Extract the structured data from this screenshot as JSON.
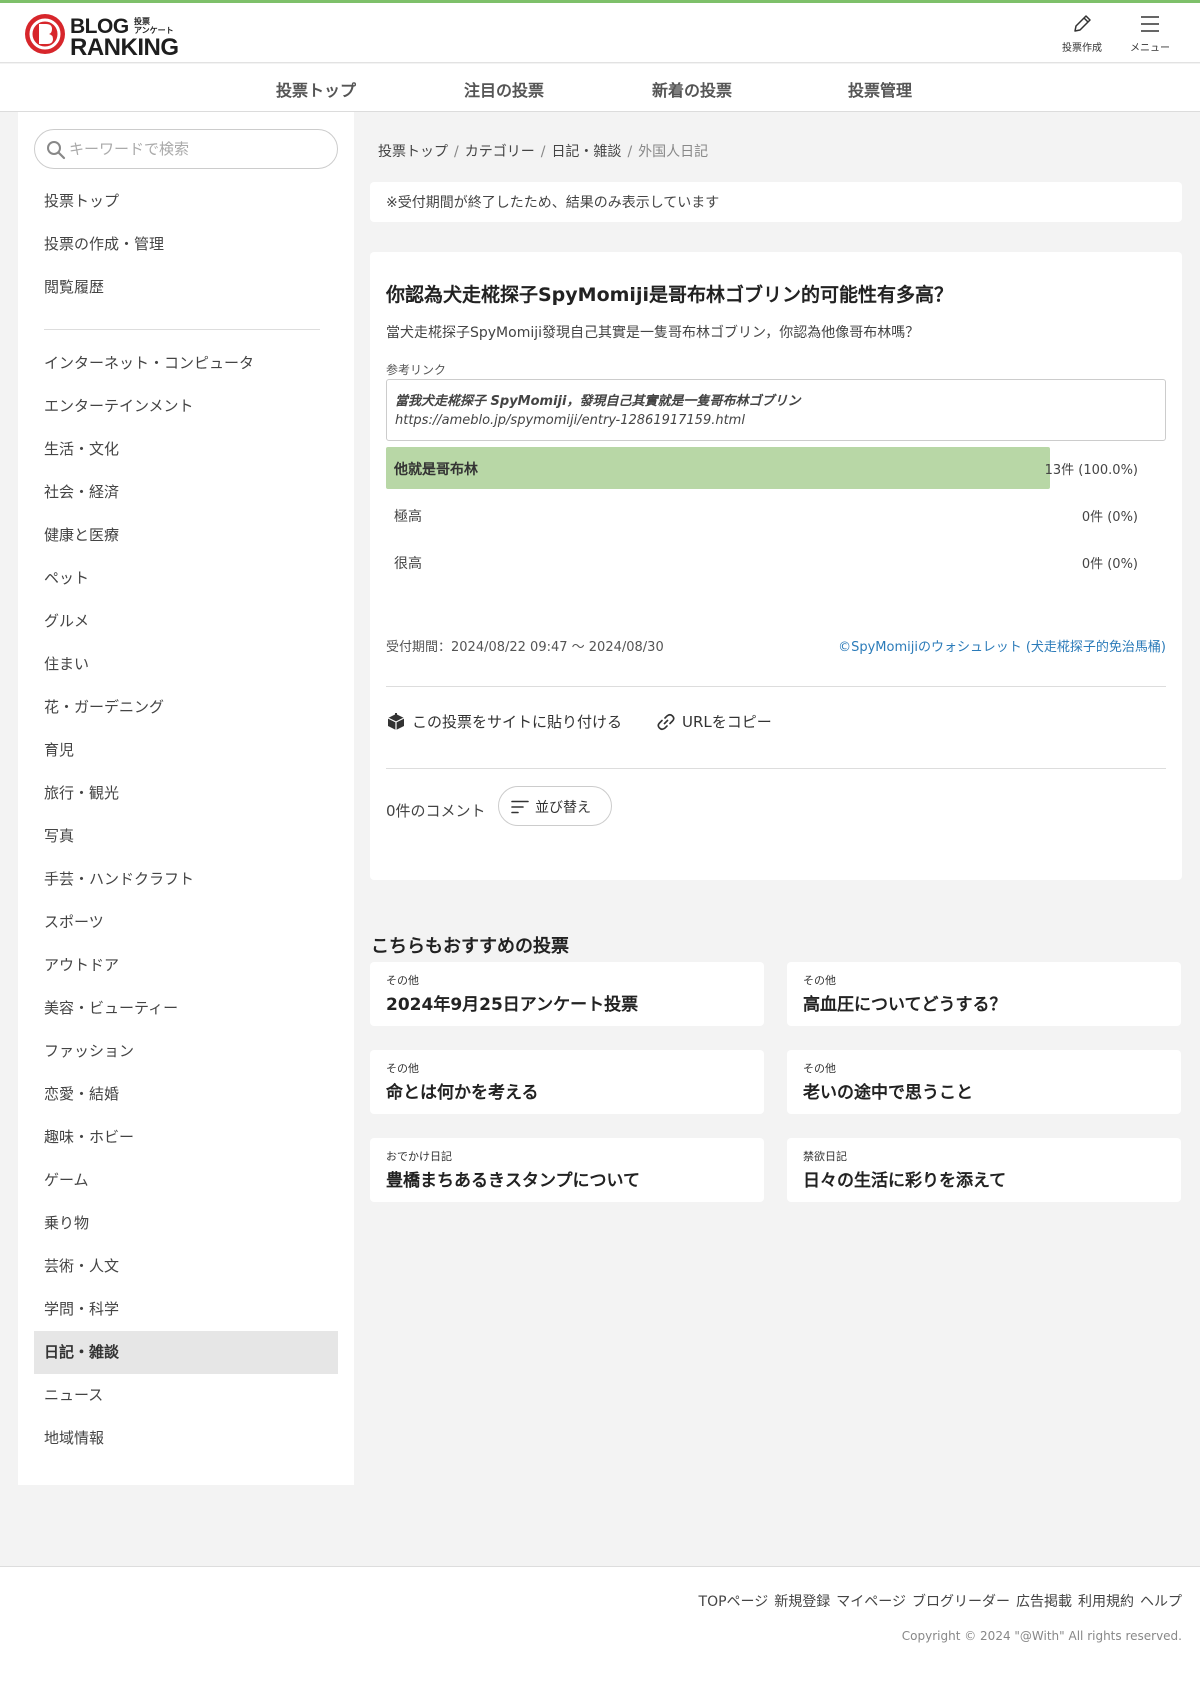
{
  "header": {
    "logo_line1": "BLOG",
    "logo_line2": "RANKING",
    "logo_small1": "投票",
    "logo_small2": "アンケート",
    "create_label": "投票作成",
    "menu_label": "メニュー"
  },
  "nav": {
    "items": [
      {
        "label": "投票トップ"
      },
      {
        "label": "注目の投票"
      },
      {
        "label": "新着の投票"
      },
      {
        "label": "投票管理"
      }
    ]
  },
  "sidebar": {
    "search_placeholder": "キーワードで検索",
    "top_items": [
      {
        "label": "投票トップ"
      },
      {
        "label": "投票の作成・管理"
      },
      {
        "label": "閲覧履歴"
      }
    ],
    "categories": [
      {
        "label": "インターネット・コンピュータ"
      },
      {
        "label": "エンターテインメント"
      },
      {
        "label": "生活・文化"
      },
      {
        "label": "社会・経済"
      },
      {
        "label": "健康と医療"
      },
      {
        "label": "ペット"
      },
      {
        "label": "グルメ"
      },
      {
        "label": "住まい"
      },
      {
        "label": "花・ガーデニング"
      },
      {
        "label": "育児"
      },
      {
        "label": "旅行・観光"
      },
      {
        "label": "写真"
      },
      {
        "label": "手芸・ハンドクラフト"
      },
      {
        "label": "スポーツ"
      },
      {
        "label": "アウトドア"
      },
      {
        "label": "美容・ビューティー"
      },
      {
        "label": "ファッション"
      },
      {
        "label": "恋愛・結婚"
      },
      {
        "label": "趣味・ホビー"
      },
      {
        "label": "ゲーム"
      },
      {
        "label": "乗り物"
      },
      {
        "label": "芸術・人文"
      },
      {
        "label": "学問・科学"
      },
      {
        "label": "日記・雑談"
      },
      {
        "label": "ニュース"
      },
      {
        "label": "地域情報"
      }
    ],
    "active_category": "日記・雑談"
  },
  "breadcrumb": {
    "items": [
      "投票トップ",
      "カテゴリー",
      "日記・雑談"
    ],
    "current": "外国人日記",
    "separator": "/"
  },
  "notice": "※受付期間が終了したため、結果のみ表示しています",
  "poll": {
    "title": "你認為犬走椛探子SpyMomiji是哥布林ゴブリン的可能性有多高？",
    "description": "當犬走椛探子SpyMomiji發現自己其實是一隻哥布林ゴブリン，你認為他像哥布林嗎？",
    "ref_label": "参考リンク",
    "ref_title": "當我犬走椛探子 SpyMomiji，發現自己其實就是一隻哥布林ゴブリン",
    "ref_url": "https://ameblo.jp/spymomiji/entry-12861917159.html",
    "options": [
      {
        "label": "他就是哥布林",
        "count": "13件 (100.0%)",
        "share": 1.0,
        "winner": true
      },
      {
        "label": "極高",
        "count": "0件 (0%)",
        "share": 0.0,
        "winner": false
      },
      {
        "label": "很高",
        "count": "0件 (0%)",
        "share": 0.0,
        "winner": false
      }
    ],
    "period": "受付期間：2024/08/22 09:47 〜 2024/08/30",
    "owner": "©SpyMomijiのウォシュレット (犬走椛探子的免治馬桶)",
    "embed_label": "この投票をサイトに貼り付ける",
    "copy_url_label": "URLをコピー",
    "comment_count": "0件のコメント",
    "sort_label": "並び替え"
  },
  "recommend": {
    "title": "こちらもおすすめの投票",
    "items": [
      {
        "cat": "その他",
        "title": "2024年9月25日アンケート投票"
      },
      {
        "cat": "その他",
        "title": "高血圧についてどうする？"
      },
      {
        "cat": "その他",
        "title": "命とは何かを考える"
      },
      {
        "cat": "その他",
        "title": "老いの途中で思うこと"
      },
      {
        "cat": "おでかけ日記",
        "title": "豊橋まちあるきスタンプについて"
      },
      {
        "cat": "禁欲日記",
        "title": "日々の生活に彩りを添えて"
      }
    ]
  },
  "footer": {
    "links": [
      "TOPページ",
      "新規登録",
      "マイページ",
      "ブログリーダー",
      "広告掲載",
      "利用規約",
      "ヘルプ"
    ],
    "copyright": "Copyright © 2024 \"@With\" All rights reserved."
  },
  "colors": {
    "accent_line": "#7ec06a",
    "bar_fill": "#b8d7a6",
    "link": "#2b7bb9",
    "logo_red": "#d7262b"
  }
}
